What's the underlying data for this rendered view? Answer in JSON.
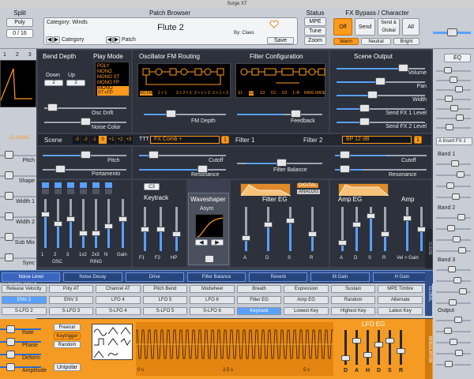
{
  "window": {
    "title": "Surge XT"
  },
  "split": {
    "label": "Split",
    "mode": "Poly",
    "voices": "0 / 16"
  },
  "patch": {
    "label": "Patch Browser",
    "category_prefix": "Category:",
    "category": "Winds",
    "name": "Flute 2",
    "author_prefix": "By:",
    "author": "Claes",
    "save": "Save",
    "category_nav": "Category",
    "patch_nav": "Patch"
  },
  "status": {
    "label": "Status",
    "mpe": "MPE",
    "tune": "Tune",
    "zoom": "Zoom"
  },
  "fx": {
    "label": "FX Bypass / Character",
    "off": "Off",
    "send": "Send",
    "send_global": "Send & Global",
    "all": "All",
    "warm": "Warm",
    "neutral": "Neutral",
    "bright": "Bright"
  },
  "sections": {
    "bend": "Bend Depth",
    "play_mode": "Play Mode",
    "osc_fm": "Oscillator FM Routing",
    "filter_config": "Filter Configuration",
    "scene_output": "Scene Output",
    "down": "Down",
    "up": "Up",
    "down_val": "2",
    "up_val": "2",
    "play_modes": [
      "POLY",
      "MONO",
      "MONO ST",
      "MONO FP",
      "MONO ST+FP",
      "LATCH"
    ],
    "osc_drift": "Osc Drift",
    "noise_color": "Noise Color",
    "fm_depth": "FM Depth",
    "feedback": "Feedback",
    "volume": "Volume",
    "pan": "Pan",
    "width": "Width",
    "send1": "Send FX 1 Level",
    "send2": "Send FX 2 Level",
    "fm_modes": [
      "NO FM",
      "2 > 1",
      "3 > 2 > 1",
      "2 > 1 < 3",
      "2 > 1 > 3"
    ],
    "filter_modes": [
      "S1",
      "S2",
      "S3",
      "D1",
      "D2",
      "L-R",
      "RING",
      "WIDE"
    ]
  },
  "left": {
    "labels": [
      "Pitch",
      "Shape",
      "Width 1",
      "Width 2",
      "Sub Mix",
      "Sync",
      "Unison Detune",
      "Unison Voices"
    ],
    "classic": "CLASSIC",
    "osc": [
      "1",
      "2",
      "3"
    ]
  },
  "scene": {
    "label": "Scene",
    "octaves": [
      "-3",
      "-2",
      "-1",
      "0",
      "+1",
      "+2",
      "+3"
    ],
    "pitch": "Pitch",
    "portamento": "Portamento"
  },
  "filter": {
    "ttt": "TTT",
    "type1": "FX Comb +",
    "filter1": "Filter 1",
    "filter2": "Filter 2",
    "type2": "BP 12 dB",
    "cutoff": "Cutoff",
    "resonance": "Resonance",
    "balance": "Filter Balance",
    "num": "1"
  },
  "mixer": {
    "labels": [
      "1",
      "2",
      "3",
      "1x2",
      "2x3",
      "N"
    ],
    "osc": "OSC",
    "ring": "RING",
    "gain": "Gain"
  },
  "keytrack": {
    "label": "Keytrack",
    "note": "C3",
    "f1": "F1",
    "f2": "F2",
    "hp": "HP"
  },
  "waveshaper": {
    "label": "Waveshaper",
    "type": "Asym"
  },
  "filter_eg": {
    "label": "Filter EG",
    "digital": "DIGITAL",
    "analog": "ANALOG",
    "adsr": [
      "A",
      "D",
      "S",
      "R"
    ]
  },
  "amp_eg": {
    "label": "Amp EG",
    "amp": "Amp",
    "velgain": "Vel > Gain",
    "adsr": [
      "A",
      "D",
      "S",
      "R"
    ]
  },
  "right": {
    "insert": "A Insert FX 1",
    "band1": "Band 1",
    "band2": "Band 2",
    "band3": "Band 3",
    "output": "Output",
    "eq": "EQ"
  },
  "mod_targets": [
    "Noise Level",
    "Noise Decay",
    "Drive",
    "Filter Balance",
    "Reverb",
    "M Gain",
    "H Gain"
  ],
  "mod_sources_1": [
    "Release Velocity",
    "Poly AT",
    "Channel AT",
    "Pitch Bend",
    "Modwheel",
    "Breath",
    "Expression",
    "Sustain",
    "MPE Timbre"
  ],
  "mod_sources_2": [
    "ENV 2",
    "ENV 3",
    "LFO 4",
    "LFO 5",
    "LFO 6",
    "Filter EG",
    "Amp EG",
    "Random",
    "Alternate"
  ],
  "mod_sources_3": [
    "S-LFO 2",
    "S-LFO 3",
    "S-LFO 4",
    "S-LFO 5",
    "S-LFO 6",
    "Keytrack",
    "Lowest Key",
    "Highest Key",
    "Latest Key"
  ],
  "lfo": {
    "rate": "Rate",
    "phase": "Phase",
    "deform": "Deform",
    "amplitude": "Amplitude",
    "freerun": "Freerun",
    "keytrigger": "Keytrigger",
    "random": "Random",
    "unipolar": "Unipolar",
    "eg": "LFO EG",
    "adsr": [
      "D",
      "A",
      "H",
      "D",
      "S",
      "R"
    ],
    "t0": "0 s",
    "t1": "2.5 s",
    "t2": "5 s"
  },
  "side": {
    "scene": "SCENE",
    "global": "GLOBAL",
    "mod": "MODULATION"
  }
}
